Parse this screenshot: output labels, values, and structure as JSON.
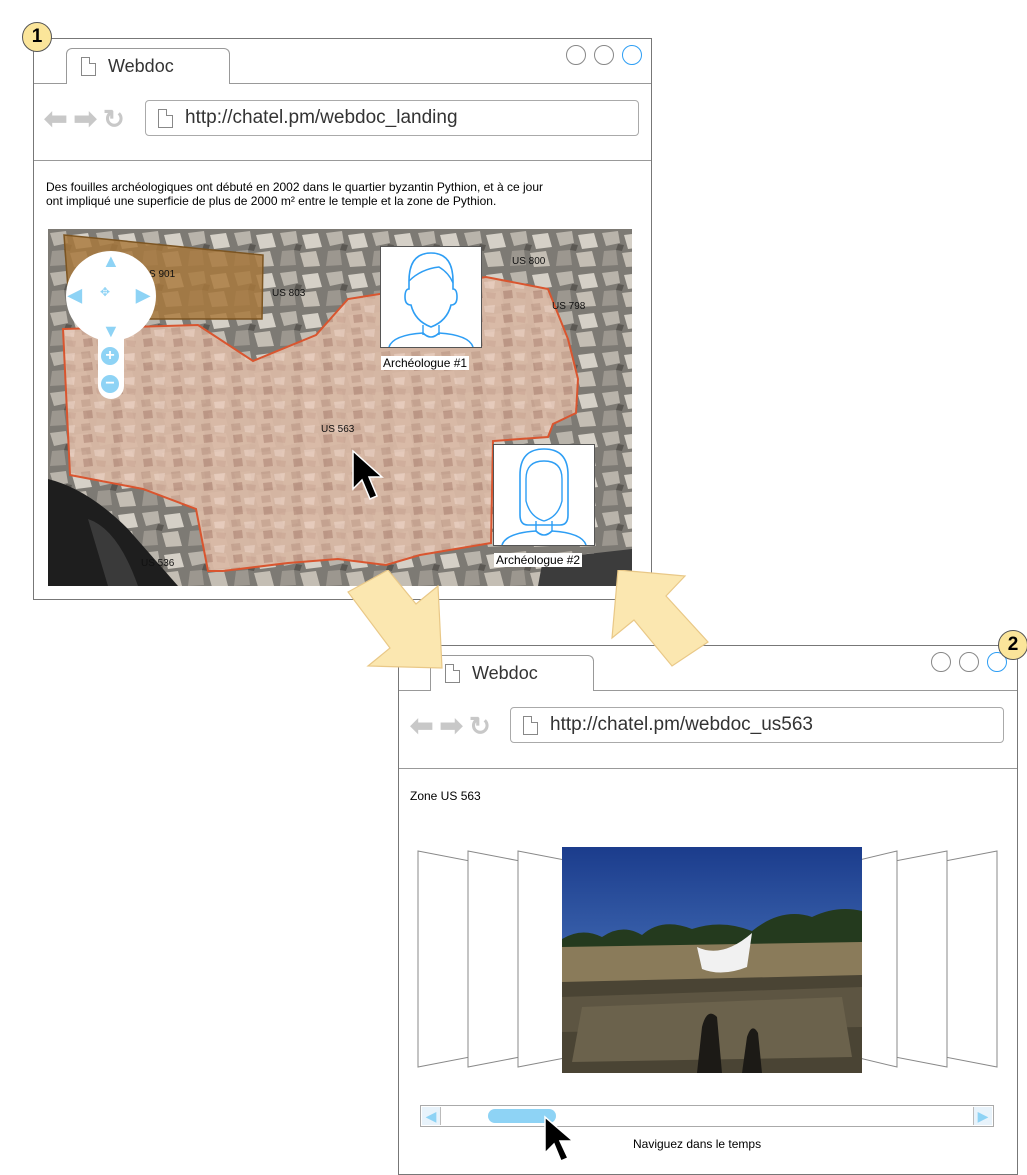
{
  "badges": {
    "step1": "1",
    "step2": "2"
  },
  "window1": {
    "tab_title": "Webdoc",
    "url": "http://chatel.pm/webdoc_landing",
    "description_line1": "Des fouilles archéologiques ont débuté en 2002 dans le quartier byzantin Pythion, et à ce jour",
    "description_line2": "ont impliqué une superficie de plus de 2000 m² entre le temple et la zone de Pythion.",
    "map_labels": {
      "s901": "S 901",
      "us803": "US 803",
      "us800": "US 800",
      "us798": "US 798",
      "us563": "US 563",
      "us536": "US 536"
    },
    "archeologue1": "Archéologue #1",
    "archeologue2": "Archéologue #2"
  },
  "window2": {
    "tab_title": "Webdoc",
    "url": "http://chatel.pm/webdoc_us563",
    "zone_title": "Zone US 563",
    "timeline_caption": "Naviguez dans le temps",
    "timeline_position": 0.1
  },
  "colors": {
    "accent_blue": "#2e9ef4",
    "zone_fill": "#e9b8a8",
    "zone_border": "#d9552f",
    "arrow_fill": "#fbe7b0",
    "badge_fill": "#fbe59a"
  }
}
